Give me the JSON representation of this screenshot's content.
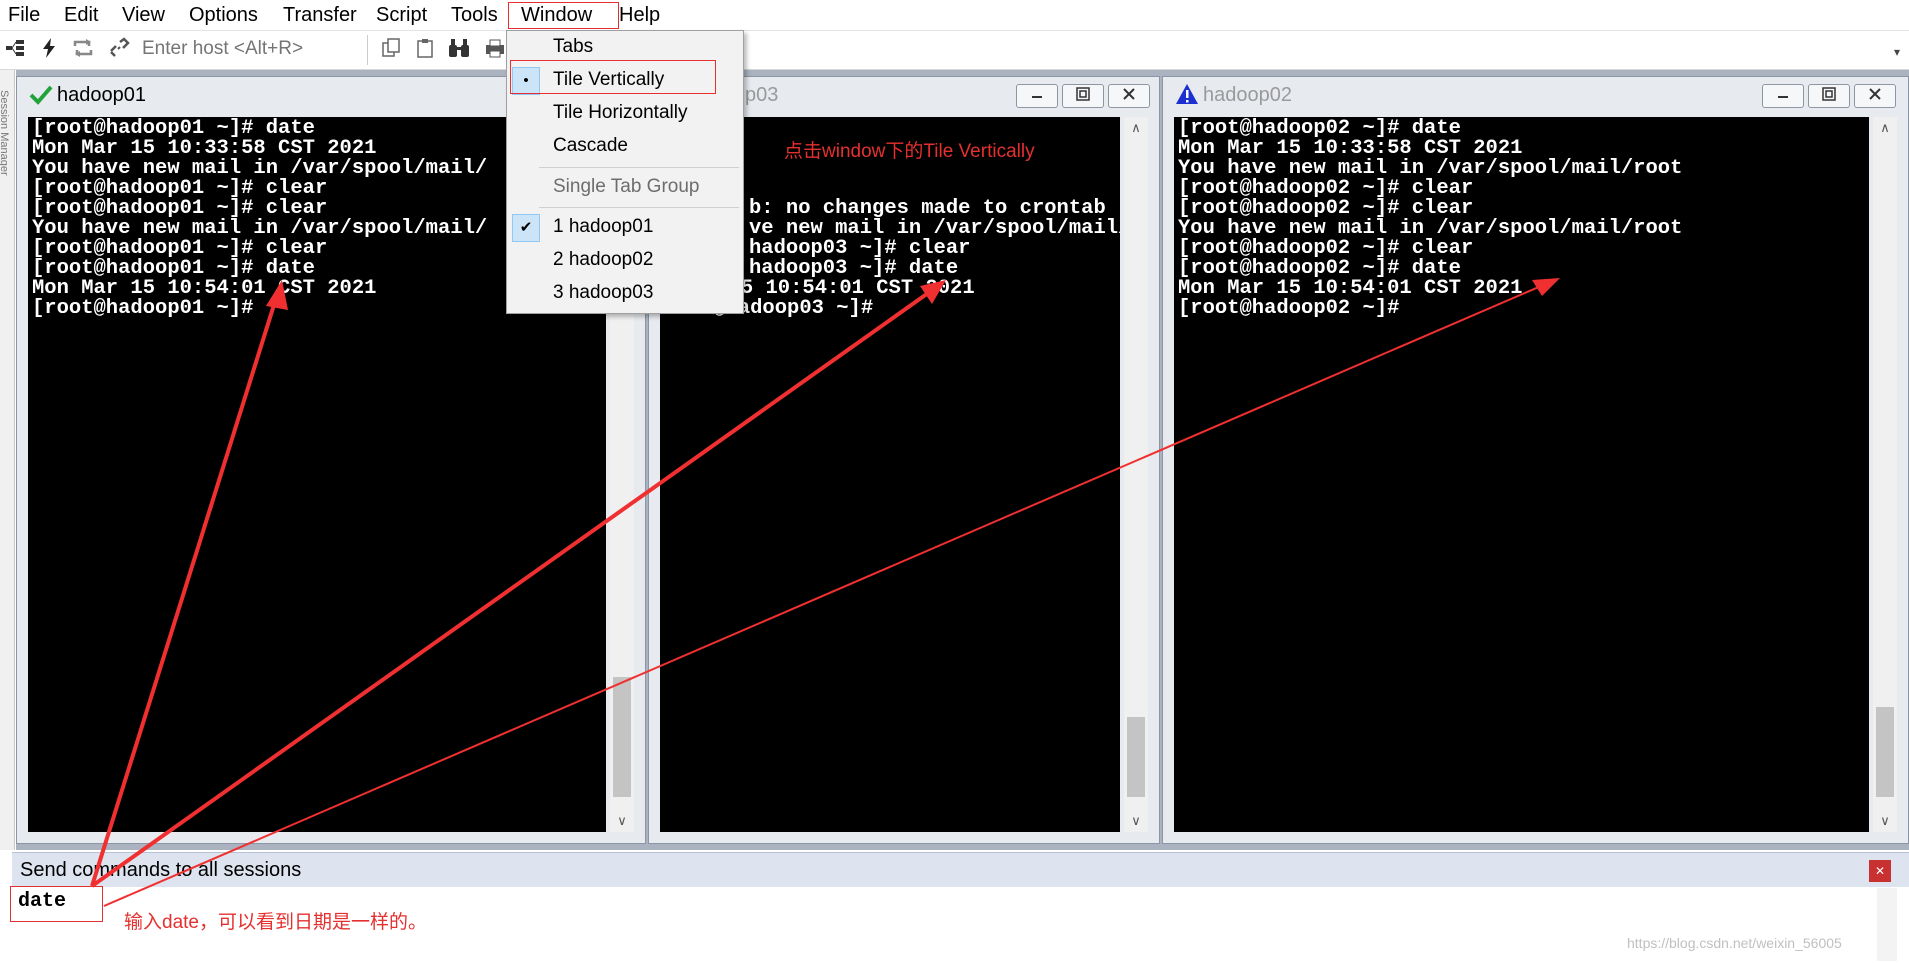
{
  "menubar": {
    "items": [
      "File",
      "Edit",
      "View",
      "Options",
      "Transfer",
      "Script",
      "Tools",
      "Window",
      "Help"
    ]
  },
  "toolbar": {
    "host_placeholder": "Enter host <Alt+R>"
  },
  "session_manager": {
    "label": "Session Manager"
  },
  "window_menu": {
    "items": [
      {
        "label": "Tabs"
      },
      {
        "label": "Tile Vertically",
        "mark": "•"
      },
      {
        "label": "Tile Horizontally"
      },
      {
        "label": "Cascade"
      },
      {
        "label": "Single Tab Group"
      },
      {
        "label": "1 hadoop01",
        "mark": "✔"
      },
      {
        "label": "2 hadoop02"
      },
      {
        "label": "3 hadoop03"
      }
    ]
  },
  "panes": [
    {
      "title": "hadoop01",
      "status": "connected",
      "lines": [
        "[root@hadoop01 ~]# date",
        "Mon Mar 15 10:33:58 CST 2021",
        "You have new mail in /var/spool/mail/",
        "[root@hadoop01 ~]# clear",
        "[root@hadoop01 ~]# clear",
        "You have new mail in /var/spool/mail/",
        "[root@hadoop01 ~]# clear",
        "[root@hadoop01 ~]# date",
        "Mon Mar 15 10:54:01 CST 2021",
        "[root@hadoop01 ~]#"
      ]
    },
    {
      "title": "p03",
      "status": "connected",
      "lines": [
        "",
        "",
        "",
        "",
        "b: no changes made to crontab",
        "ve new mail in /var/spool/mail/root",
        "hadoop03 ~]# clear",
        "hadoop03 ~]# date",
        "r 15 10:54:01 CST 2021",
        "root@hadoop03 ~]#"
      ]
    },
    {
      "title": "hadoop02",
      "status": "warning",
      "lines": [
        "[root@hadoop02 ~]# date",
        "Mon Mar 15 10:33:58 CST 2021",
        "You have new mail in /var/spool/mail/root",
        "[root@hadoop02 ~]# clear",
        "[root@hadoop02 ~]# clear",
        "You have new mail in /var/spool/mail/root",
        "[root@hadoop02 ~]# clear",
        "[root@hadoop02 ~]# date",
        "Mon Mar 15 10:54:01 CST 2021",
        "[root@hadoop02 ~]#"
      ]
    }
  ],
  "send_panel": {
    "title": "Send commands to all sessions",
    "text": "date"
  },
  "annotations": {
    "menu_note": "点击window下的Tile Vertically",
    "input_note": "输入date，可以看到日期是一样的。",
    "watermark": "https://blog.csdn.net/weixin_56005"
  },
  "colors": {
    "annotation_red": "#e53030",
    "terminal_bg": "#000000",
    "terminal_fg": "#ffffff",
    "menu_highlight": "#cce4f7"
  }
}
